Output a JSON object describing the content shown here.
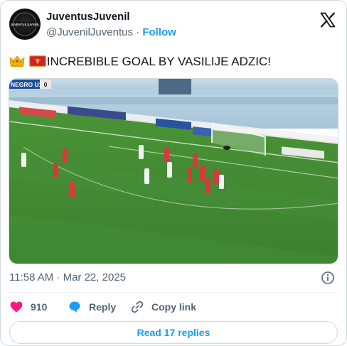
{
  "account": {
    "display_name": "JuventusJuvenil",
    "handle": "@JuvenilJuventus",
    "separator": "·",
    "follow_label": "Follow",
    "avatar_text": "JUVENTUSJUVENIL"
  },
  "tweet": {
    "text": "INCREBIBLE GOAL BY VASILIJE ADZIC!",
    "emojis": [
      "crown-emoji",
      "montenegro-flag-emoji"
    ],
    "timestamp": "11:58 AM · Mar 22, 2025"
  },
  "media": {
    "scoreboard_team": "NEGRO U19",
    "scoreboard_score": "0"
  },
  "actions": {
    "likes_count": "910",
    "reply_label": "Reply",
    "copy_link_label": "Copy link"
  },
  "read_replies_label": "Read 17 replies",
  "colors": {
    "like": "#f91880",
    "reply": "#1d9bf0",
    "link": "#1d9bf0",
    "text_secondary": "#536471",
    "pitch": "#3f8a2f"
  }
}
